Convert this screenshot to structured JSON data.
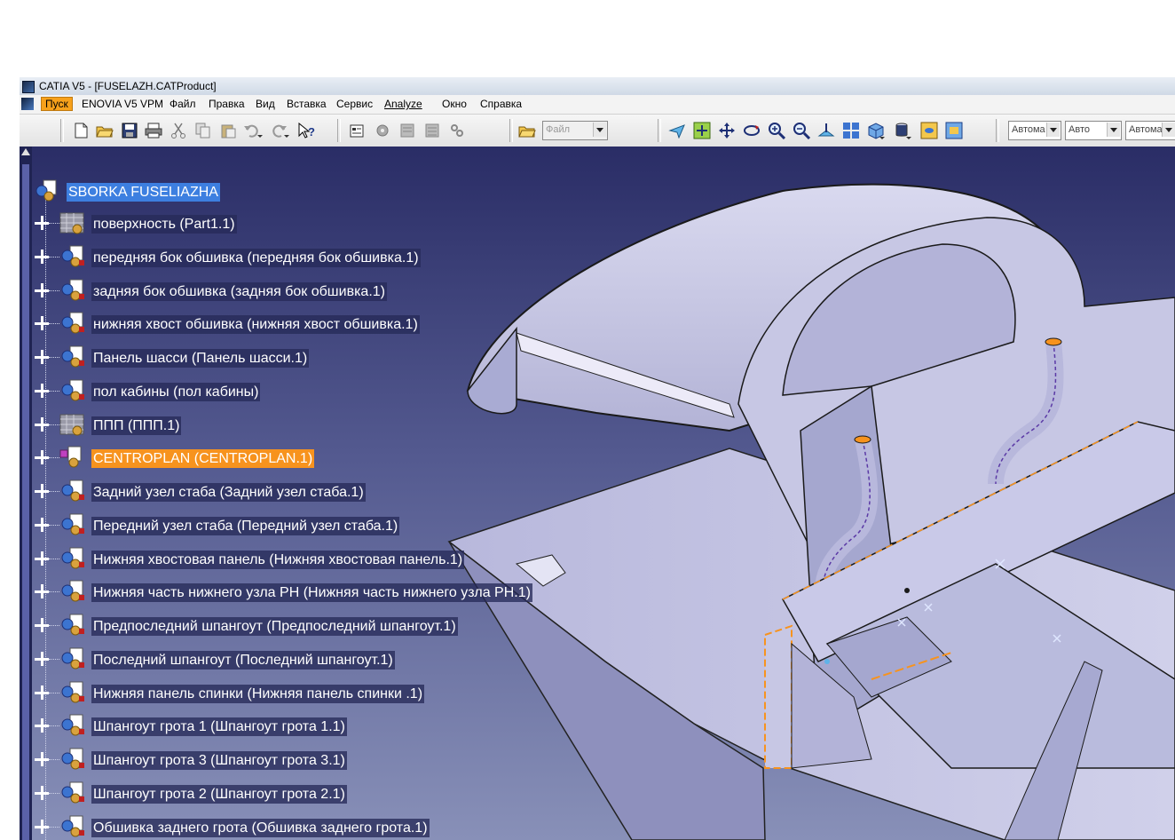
{
  "window": {
    "title": "CATIA V5 - [FUSELAZH.CATProduct]"
  },
  "menu": {
    "items": [
      "Пуск",
      "ENOVIA V5 VPM",
      "Файл",
      "Правка",
      "Вид",
      "Вставка",
      "Сервис",
      "Analyze",
      "Окно",
      "Справка"
    ],
    "active_index": 0
  },
  "toolbar": {
    "file_combo": "Файл",
    "combos": [
      "Автома",
      "Авто",
      "Автома"
    ],
    "buttons": [
      "new-icon",
      "open-icon",
      "save-icon",
      "print-icon",
      "cut-icon",
      "copy-icon",
      "paste-icon",
      "undo-icon",
      "redo-icon",
      "whats-this-icon",
      "catalog-icon",
      "properties-icon",
      "product-icon",
      "component-icon",
      "tools-icon",
      "open-folder-icon",
      "fly-mode-icon",
      "fit-all-icon",
      "pan-icon",
      "rotate-icon",
      "zoom-in-icon",
      "zoom-out-icon",
      "normal-view-icon",
      "multi-view-icon",
      "iso-view-icon",
      "shading-icon",
      "hide-show-icon",
      "swap-space-icon"
    ]
  },
  "tree": {
    "root": "SBORKA FUSELIAZHA",
    "nodes": [
      {
        "label": "поверхность (Part1.1)",
        "type": "part-grey"
      },
      {
        "label": "передняя бок обшивка (передняя бок обшивка.1)",
        "type": "product"
      },
      {
        "label": "задняя бок обшивка (задняя бок обшивка.1)",
        "type": "product"
      },
      {
        "label": "нижняя хвост обшивка (нижняя хвост обшивка.1)",
        "type": "product"
      },
      {
        "label": "Панель шасси (Панель шасси.1)",
        "type": "product"
      },
      {
        "label": "пол кабины (пол кабины)",
        "type": "product"
      },
      {
        "label": "ППП (ППП.1)",
        "type": "part-grey"
      },
      {
        "label": "CENTROPLAN (CENTROPLAN.1)",
        "type": "product-active",
        "highlight": "orange"
      },
      {
        "label": "Задний узел стаба (Задний узел стаба.1)",
        "type": "product"
      },
      {
        "label": "Передний узел стаба (Передний узел стаба.1)",
        "type": "product"
      },
      {
        "label": "Нижняя хвостовая панель (Нижняя хвостовая панель.1)",
        "type": "product"
      },
      {
        "label": "Нижняя часть нижнего узла РН (Нижняя часть нижнего узла РН.1)",
        "type": "product"
      },
      {
        "label": "Предпоследний шпангоут (Предпоследний шпангоут.1)",
        "type": "product"
      },
      {
        "label": "Последний шпангоут (Последний шпангоут.1)",
        "type": "product"
      },
      {
        "label": "Нижняя панель спинки  (Нижняя панель спинки .1)",
        "type": "product"
      },
      {
        "label": "Шпангоут грота 1 (Шпангоут грота 1.1)",
        "type": "product"
      },
      {
        "label": "Шпангоут грота 3 (Шпангоут грота 3.1)",
        "type": "product"
      },
      {
        "label": "Шпангоут грота 2 (Шпангоут грота 2.1)",
        "type": "product"
      },
      {
        "label": "Обшивка заднего грота (Обшивка заднего грота.1)",
        "type": "product"
      }
    ]
  },
  "colors": {
    "viewport_top": "#2a2d66",
    "viewport_bottom": "#8890b8",
    "model": "#c9c9e6",
    "accent": "#f7931e",
    "selection": "#3d7fe0"
  }
}
